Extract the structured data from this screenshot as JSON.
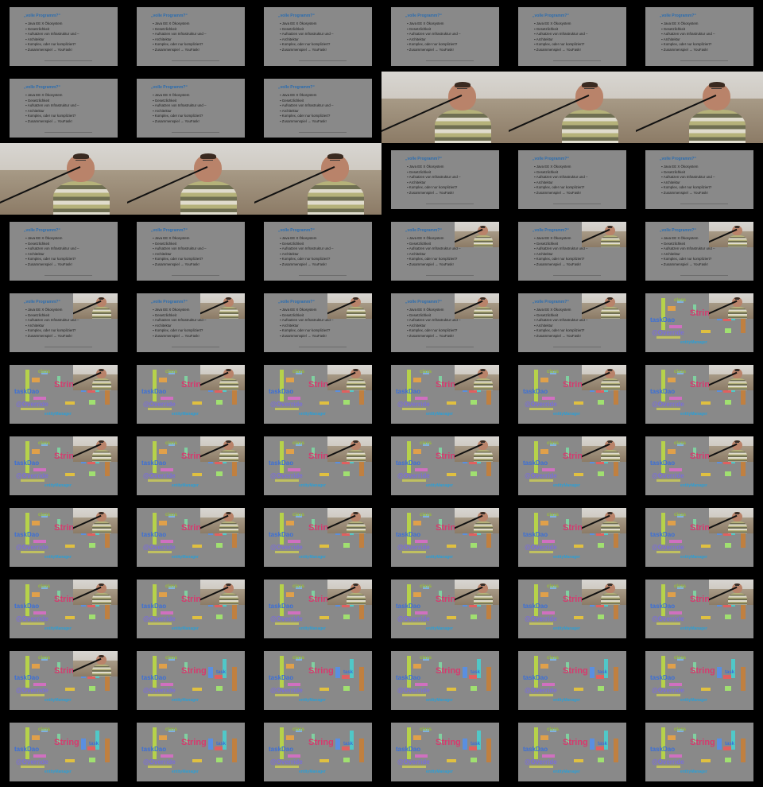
{
  "slide_text": {
    "title": "„volle Programm?“",
    "bullets": [
      "Java EE X Ökosystem",
      "Gesetzlichkeit",
      "Aufsatzen von Infrastruktur und –",
      "Architektur",
      "Komplex, oder nur kompliziert?",
      "Zusammenspiel → YouFask!"
    ]
  },
  "cloud_words": [
    "class",
    "String",
    "taskDao",
    "@Override",
    "task",
    "entityManager"
  ],
  "colors": {
    "background": "#000000",
    "slide": "#898989",
    "title": "#2b6db0",
    "word_string": "#d63a6e",
    "word_task": "#3a6fd8",
    "word_override": "#7b6fd8",
    "word_class": "#9bbf3a",
    "word_entity": "#2b9fd6"
  },
  "grid": [
    [
      "slide",
      "slide",
      "slide",
      "slide",
      "slide",
      "slide"
    ],
    [
      "slide",
      "slide",
      "slide",
      "camera",
      "camera",
      "camera"
    ],
    [
      "camera",
      "camera",
      "camera",
      "slide",
      "slide",
      "slide"
    ],
    [
      "slide",
      "slide",
      "slide",
      "slide-pip",
      "slide-pip",
      "slide-pip"
    ],
    [
      "slide-pip",
      "slide-pip",
      "slide-pip",
      "slide-pip",
      "slide-pip",
      "cloud-pip"
    ],
    [
      "cloud-pip",
      "cloud-pip",
      "cloud-pip",
      "cloud-pip",
      "cloud-pip",
      "cloud-pip"
    ],
    [
      "cloud-pip",
      "cloud-pip",
      "cloud-pip",
      "cloud-pip",
      "cloud-pip",
      "cloud-pip"
    ],
    [
      "cloud-pip",
      "cloud-pip",
      "cloud-pip",
      "cloud-pip",
      "cloud-pip",
      "cloud-pip"
    ],
    [
      "cloud-pip",
      "cloud-pip",
      "cloud-pip",
      "cloud-pip",
      "cloud-pip",
      "cloud-pip"
    ],
    [
      "cloud-pip",
      "cloud",
      "cloud",
      "cloud",
      "cloud",
      "cloud"
    ],
    [
      "cloud",
      "cloud",
      "cloud",
      "cloud",
      "cloud",
      "cloud"
    ]
  ]
}
